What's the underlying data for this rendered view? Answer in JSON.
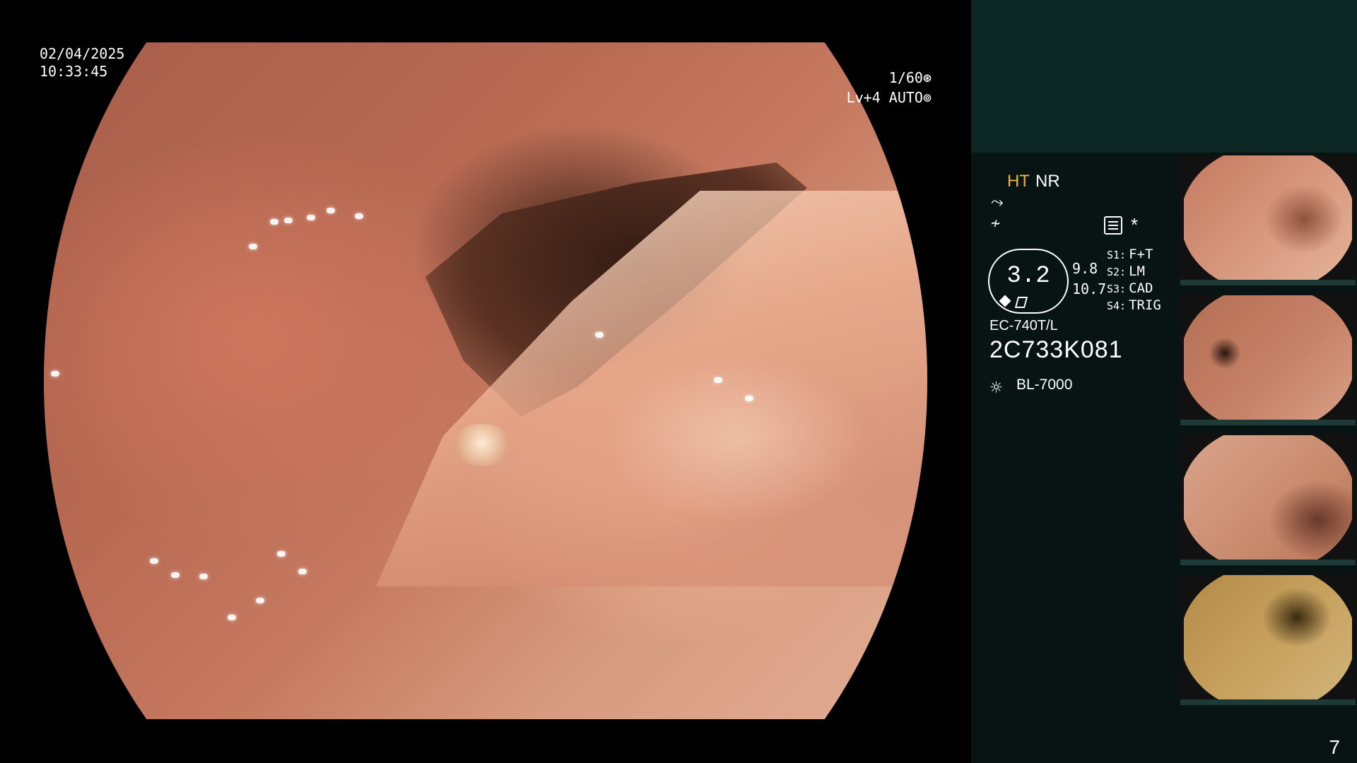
{
  "overlay": {
    "date": "02/04/2025",
    "time": "10:33:45",
    "shutter": "1/60",
    "shutter_icon": "aperture-icon",
    "level": "Lv+4 AUTO",
    "level_icon": "iris-icon"
  },
  "panel": {
    "ht_label": "HT",
    "nr_label": "NR",
    "enhance1_icon": "structure-enhance-icon",
    "enhance2_icon": "edge-enhance-icon",
    "menu_icon": "menu-icon",
    "star_label": "*",
    "gauge_value": "3.2",
    "gauge_right_top": "9.8",
    "gauge_right_bottom": "10.7",
    "switches": [
      {
        "key": "S1:",
        "value": "F+T"
      },
      {
        "key": "S2:",
        "value": "LM"
      },
      {
        "key": "S3:",
        "value": "CAD"
      },
      {
        "key": "S4:",
        "value": "TRIG"
      }
    ],
    "scope_model": "EC-740T/L",
    "scope_serial": "2C733K081",
    "light_source": "BL-7000",
    "page_number": "7"
  },
  "colors": {
    "ht_accent": "#f2b24a",
    "panel_bg": "#081413",
    "panel_top_bg": "#0c2624"
  }
}
